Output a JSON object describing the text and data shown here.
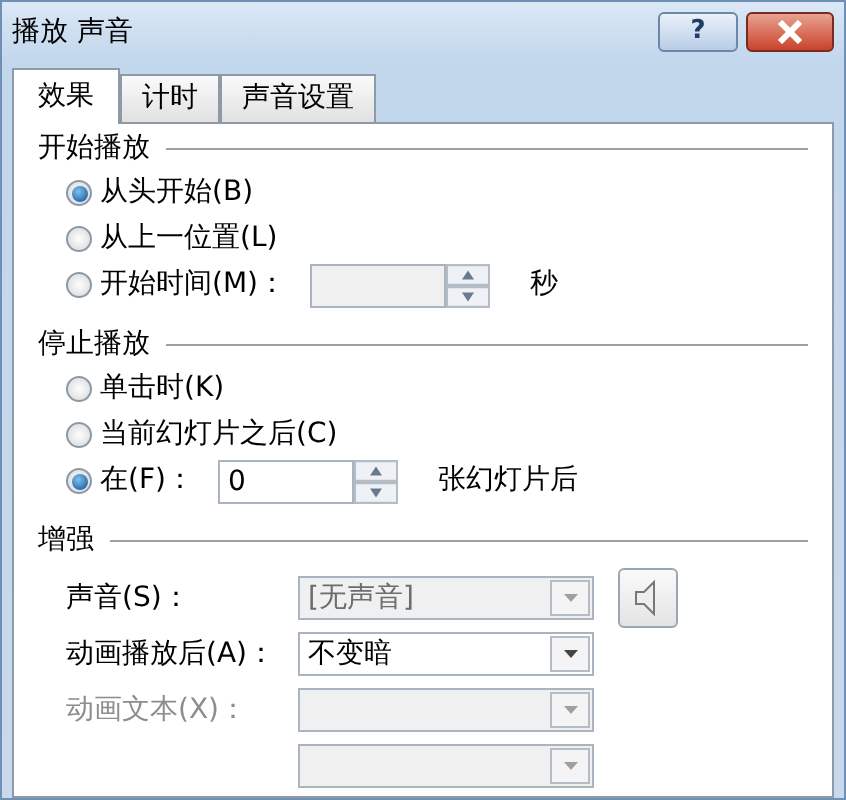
{
  "window": {
    "title": "播放 声音",
    "help": "?"
  },
  "tabs": [
    {
      "label": "效果",
      "selected": true
    },
    {
      "label": "计时",
      "selected": false
    },
    {
      "label": "声音设置",
      "selected": false
    }
  ],
  "start_group": {
    "title": "开始播放",
    "options": [
      {
        "label": "从头开始(B)",
        "selected": true
      },
      {
        "label": "从上一位置(L)",
        "selected": false
      },
      {
        "label": "开始时间(M)：",
        "selected": false,
        "kind": "spin",
        "field": {
          "disabled": true
        },
        "unit": "秒"
      }
    ]
  },
  "stop_group": {
    "title": "停止播放",
    "options": [
      {
        "label": "单击时(K)",
        "selected": false
      },
      {
        "label": "当前幻灯片之后(C)",
        "selected": false
      },
      {
        "label": "在(F)：",
        "selected": true,
        "kind": "spin",
        "field": {
          "value": "0",
          "disabled": false
        },
        "unit": "张幻灯片后"
      }
    ]
  },
  "enhance_group": {
    "title": "增强",
    "rows": [
      {
        "kind": "combo",
        "label": "声音(S)：",
        "value": "[无声音]",
        "disabled": true,
        "speaker_button": true
      },
      {
        "kind": "combo",
        "label": "动画播放后(A)：",
        "value": "不变暗",
        "disabled": false
      },
      {
        "kind": "combo",
        "label": "动画文本(X)：",
        "disabled": true,
        "label_disabled": true
      },
      {
        "kind": "combo",
        "disabled": true
      }
    ]
  }
}
